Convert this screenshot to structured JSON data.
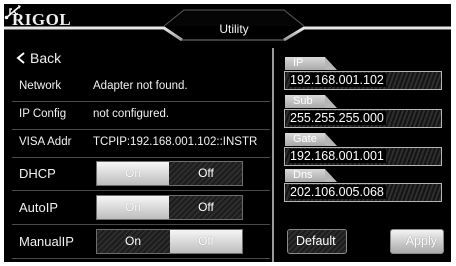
{
  "header": {
    "brand": "RIGOL",
    "title": "Utility"
  },
  "nav": {
    "back_label": "Back"
  },
  "info": [
    {
      "label": "Network",
      "value": "Adapter not found."
    },
    {
      "label": "IP Config",
      "value": "not configured."
    },
    {
      "label": "VISA Addr",
      "value": "TCPIP:192.168.001.102::INSTR"
    }
  ],
  "options": [
    {
      "label": "DHCP",
      "on_label": "On",
      "off_label": "Off",
      "selected": "On"
    },
    {
      "label": "AutoIP",
      "on_label": "On",
      "off_label": "Off",
      "selected": "On"
    },
    {
      "label": "ManualIP",
      "on_label": "On",
      "off_label": "Off",
      "selected": "Off"
    }
  ],
  "fields": [
    {
      "label": "IP",
      "value": "192.168.001.102"
    },
    {
      "label": "Sub",
      "value": "255.255.255.000"
    },
    {
      "label": "Gate",
      "value": "192.168.001.001"
    },
    {
      "label": "Dns",
      "value": "202.106.005.068"
    }
  ],
  "buttons": {
    "default_label": "Default",
    "apply_label": "Apply"
  },
  "colors": {
    "background": "#000000",
    "accent": "#c8c8c8",
    "text": "#f2f2f2"
  },
  "icons": {
    "usb": "usb-icon",
    "back": "chevron-left-icon"
  }
}
